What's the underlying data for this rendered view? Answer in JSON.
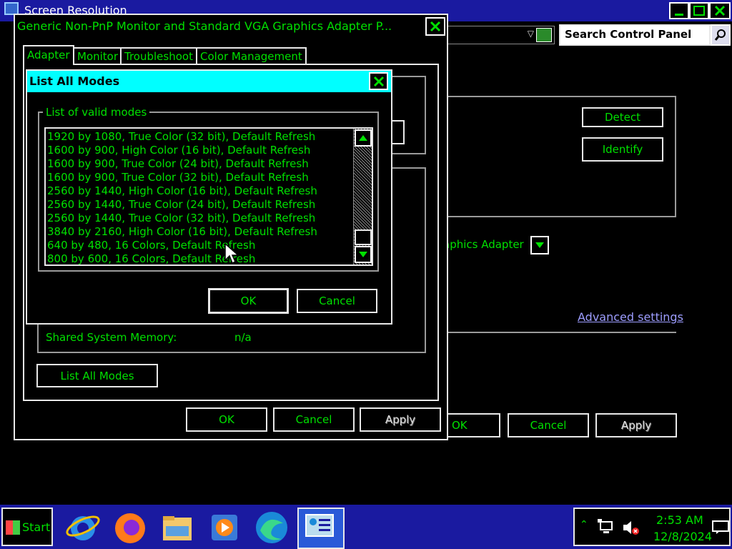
{
  "background_window": {
    "title": "Screen Resolution",
    "search_placeholder": "Search Control Panel",
    "detect_label": "Detect",
    "identify_label": "Identify",
    "display_value": "aphics Adapter",
    "advanced_link": "Advanced settings",
    "ok_label": "OK",
    "cancel_label": "Cancel",
    "apply_label": "Apply"
  },
  "properties_dialog": {
    "title": "Generic Non-PnP Monitor and Standard VGA Graphics Adapter P...",
    "tabs": [
      {
        "label": "Adapter"
      },
      {
        "label": "Monitor"
      },
      {
        "label": "Troubleshoot"
      },
      {
        "label": "Color Management"
      }
    ],
    "shared_memory_label": "Shared System Memory:",
    "shared_memory_value": "n/a",
    "list_all_modes_label": "List All Modes",
    "ok_label": "OK",
    "cancel_label": "Cancel",
    "apply_label": "Apply"
  },
  "modes_dialog": {
    "title": "List All Modes",
    "group_label": "List of valid modes",
    "modes": [
      "1920 by 1080, True Color (32 bit), Default Refresh",
      "1600 by 900, High Color (16 bit), Default Refresh",
      "1600 by 900, True Color (24 bit), Default Refresh",
      "1600 by 900, True Color (32 bit), Default Refresh",
      "2560 by 1440, High Color (16 bit), Default Refresh",
      "2560 by 1440, True Color (24 bit), Default Refresh",
      "2560 by 1440, True Color (32 bit), Default Refresh",
      "3840 by 2160, High Color (16 bit), Default Refresh",
      "640 by 480, 16 Colors, Default Refresh",
      "800 by 600, 16 Colors, Default Refresh"
    ],
    "ok_label": "OK",
    "cancel_label": "Cancel"
  },
  "taskbar": {
    "start_label": "Start",
    "time": "2:53 AM",
    "date": "12/8/2024",
    "icons": [
      "internet-explorer-icon",
      "firefox-icon",
      "file-explorer-icon",
      "media-player-icon",
      "edge-icon",
      "control-panel-icon"
    ]
  },
  "colors": {
    "text": "#00e000",
    "title_bar": "#00ffff",
    "taskbar": "#1a1aa0",
    "link": "#9d9dff"
  }
}
